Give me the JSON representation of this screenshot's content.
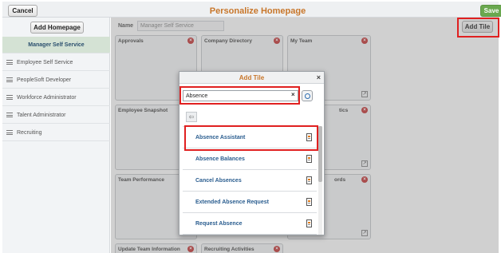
{
  "header": {
    "cancel_label": "Cancel",
    "title": "Personalize Homepage",
    "save_label": "Save"
  },
  "sidebar": {
    "add_homepage_label": "Add Homepage",
    "items": [
      {
        "label": "Manager Self Service"
      },
      {
        "label": "Employee Self Service"
      },
      {
        "label": "PeopleSoft Developer"
      },
      {
        "label": "Workforce Administrator"
      },
      {
        "label": "Talent Administrator"
      },
      {
        "label": "Recruiting"
      }
    ]
  },
  "main": {
    "name_label": "Name",
    "name_value": "Manager Self Service",
    "add_tile_label": "Add Tile",
    "tiles": [
      {
        "title": "Approvals"
      },
      {
        "title": "Company Directory"
      },
      {
        "title": "My Team"
      },
      {
        "title": "Employee Snapshot"
      },
      {
        "title": "tics"
      },
      {
        "title": "Team Performance"
      },
      {
        "title": "ords"
      },
      {
        "title": "Update Team Information"
      },
      {
        "title": "Recruiting Activities"
      }
    ]
  },
  "modal": {
    "title": "Add Tile",
    "close_glyph": "×",
    "search_value": "Absence",
    "clear_glyph": "×",
    "back_glyph": "⇦",
    "items": [
      {
        "label": "Absence Assistant"
      },
      {
        "label": "Absence Balances"
      },
      {
        "label": "Cancel Absences"
      },
      {
        "label": "Extended Absence Request"
      },
      {
        "label": "Request Absence"
      }
    ]
  },
  "colors": {
    "accent": "#c8762a",
    "link": "#2a5d8f",
    "highlight": "#e02020",
    "save": "#6aa84f"
  }
}
